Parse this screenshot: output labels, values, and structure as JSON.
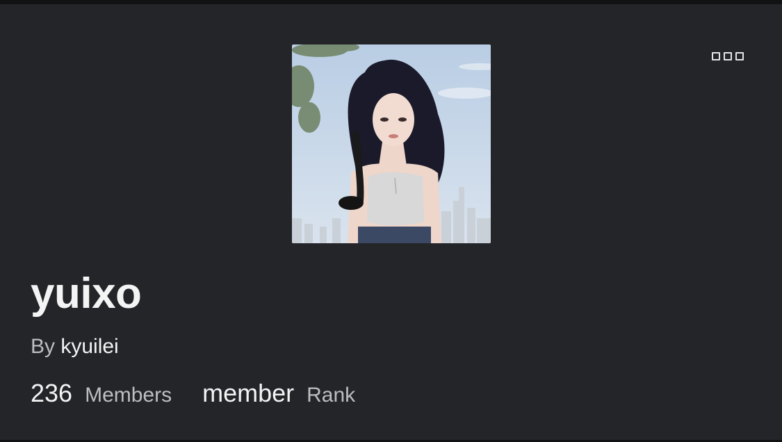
{
  "group": {
    "name": "yuixo",
    "owner_prefix": "By",
    "owner_name": "kyuilei",
    "icon": "group-avatar-image"
  },
  "stats": {
    "members_count": "236",
    "members_label": "Members",
    "rank_value": "member",
    "rank_label": "Rank"
  },
  "menu": {
    "icon": "more-options-icon"
  },
  "colors": {
    "background": "#232529",
    "text_primary": "#f4f4f5",
    "text_secondary": "#bdbec0"
  }
}
